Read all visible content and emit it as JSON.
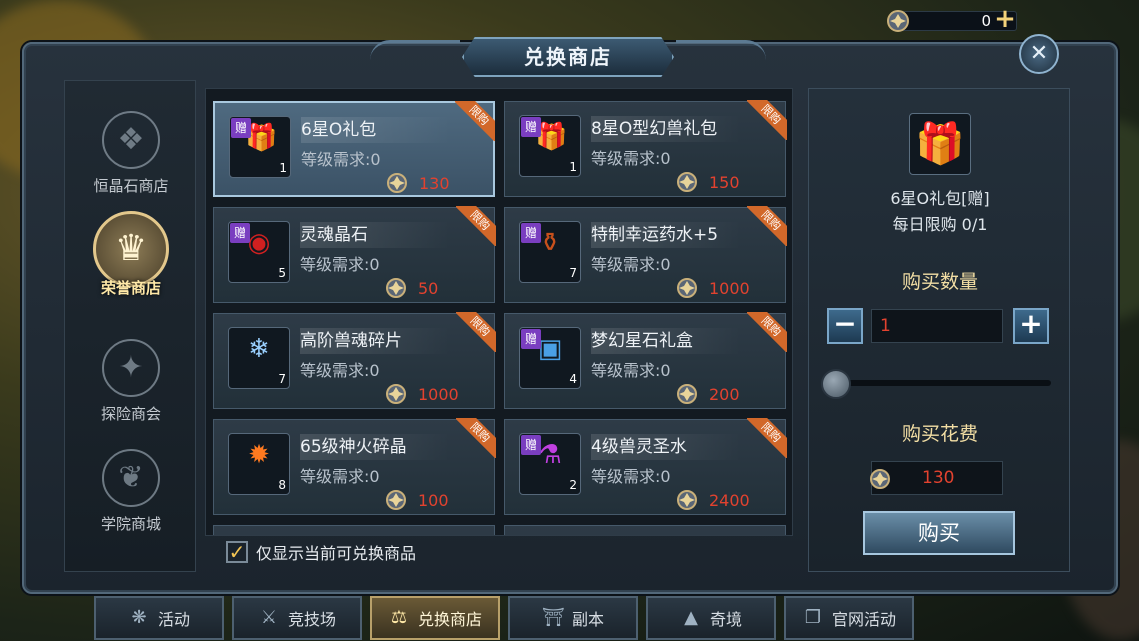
{
  "window": {
    "title": "兑换商店",
    "close_icon": "close-x-icon"
  },
  "currency": {
    "value": "0",
    "icon": "badge-coin-icon",
    "add_icon": "plus-icon"
  },
  "nav": [
    {
      "label": "恒晶石商店",
      "icon": "crystal-emblem-icon",
      "active": false
    },
    {
      "label": "荣誉商店",
      "icon": "trophy-emblem-icon",
      "active": true
    },
    {
      "label": "探险商会",
      "icon": "adventure-emblem-icon",
      "active": false
    },
    {
      "label": "学院商城",
      "icon": "book-emblem-icon",
      "active": false
    }
  ],
  "items": [
    {
      "name": "6星O礼包",
      "level": "等级需求:0",
      "price": "130",
      "qty": "1",
      "badge": "赠",
      "ribbon": "限购",
      "icon": "red-gift-icon",
      "selected": true
    },
    {
      "name": "8星O型幻兽礼包",
      "level": "等级需求:0",
      "price": "150",
      "qty": "1",
      "badge": "赠",
      "ribbon": "限购",
      "icon": "gold-gift-icon",
      "selected": false
    },
    {
      "name": "灵魂晶石",
      "level": "等级需求:0",
      "price": "50",
      "qty": "5",
      "badge": "赠",
      "ribbon": "限购",
      "icon": "soul-stone-icon",
      "selected": false
    },
    {
      "name": "特制幸运药水+5",
      "level": "等级需求:0",
      "price": "1000",
      "qty": "7",
      "badge": "赠",
      "ribbon": "限购",
      "icon": "potion-flask-icon",
      "selected": false
    },
    {
      "name": "高阶兽魂碎片",
      "level": "等级需求:0",
      "price": "1000",
      "qty": "7",
      "badge": "",
      "ribbon": "限购",
      "icon": "crystal-shard-icon",
      "selected": false
    },
    {
      "name": "梦幻星石礼盒",
      "level": "等级需求:0",
      "price": "200",
      "qty": "4",
      "badge": "赠",
      "ribbon": "限购",
      "icon": "treasure-chest-icon",
      "selected": false
    },
    {
      "name": "65级神火碎晶",
      "level": "等级需求:0",
      "price": "100",
      "qty": "8",
      "badge": "",
      "ribbon": "限购",
      "icon": "fire-crystal-icon",
      "selected": false
    },
    {
      "name": "4级兽灵圣水",
      "level": "等级需求:0",
      "price": "2400",
      "qty": "2",
      "badge": "赠",
      "ribbon": "限购",
      "icon": "purple-potion-icon",
      "selected": false
    }
  ],
  "filter": {
    "label": "仅显示当前可兑换商品",
    "checked": true
  },
  "detail": {
    "name": "6星O礼包[赠]",
    "limit": "每日限购 0/1",
    "qty_label": "购买数量",
    "qty_value": "1",
    "minus": "−",
    "plus": "+",
    "slider_fraction": 0,
    "cost_label": "购买花费",
    "cost_value": "130",
    "buy_label": "购买"
  },
  "tabs": [
    {
      "label": "活动",
      "icon": "gear-flower-icon",
      "active": false
    },
    {
      "label": "竞技场",
      "icon": "crossed-swords-icon",
      "active": false
    },
    {
      "label": "兑换商店",
      "icon": "scales-icon",
      "active": true
    },
    {
      "label": "副本",
      "icon": "gate-icon",
      "active": false
    },
    {
      "label": "奇境",
      "icon": "mountain-icon",
      "active": false
    },
    {
      "label": "官网活动",
      "icon": "open-book-icon",
      "active": false
    }
  ],
  "colors": {
    "price_red": "#e2422f",
    "ribbon_orange": "#d2682a",
    "gold_text": "#f2dea4",
    "badge_purple": "#7a3ec0"
  }
}
